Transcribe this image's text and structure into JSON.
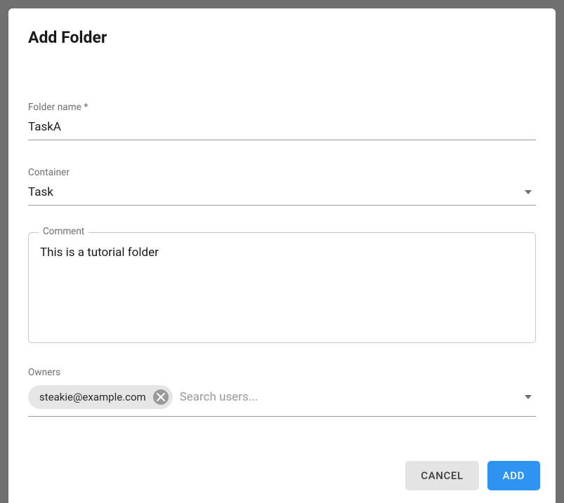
{
  "dialog": {
    "title": "Add Folder"
  },
  "fields": {
    "folderName": {
      "label": "Folder name *",
      "value": "TaskA"
    },
    "container": {
      "label": "Container",
      "value": "Task"
    },
    "comment": {
      "label": "Comment",
      "value": "This is a tutorial folder"
    },
    "owners": {
      "label": "Owners",
      "placeholder": "Search users...",
      "chips": [
        {
          "label": "steakie@example.com"
        }
      ]
    }
  },
  "actions": {
    "cancel": "CANCEL",
    "add": "ADD"
  }
}
